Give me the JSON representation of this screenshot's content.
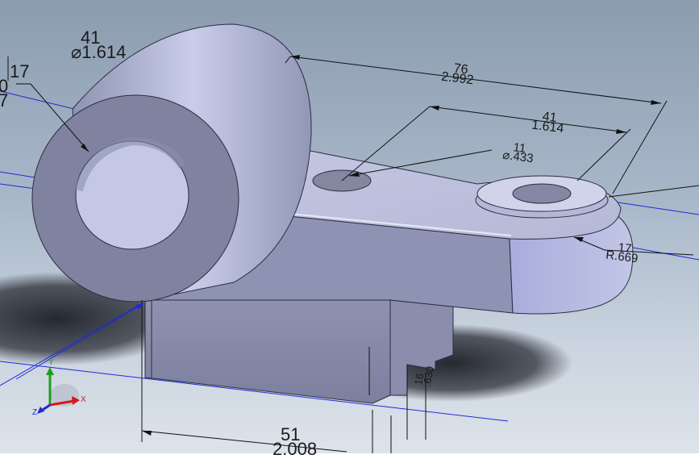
{
  "viewport": {
    "background_top": "#8c9cb0",
    "background_bottom": "#dde3ea",
    "part_color": "#9ea3c4"
  },
  "dimensions": {
    "left_bore_upper": "17",
    "left_bore_lower": "0",
    "left_bore_third": "7",
    "boss_diameter_mm": "41",
    "boss_diameter_in": "⌀1.614",
    "overall_length_mm": "76",
    "overall_length_in": "2.992",
    "hole_spacing_mm": "41",
    "hole_spacing_in": "1.614",
    "hole_diameter_mm": "11",
    "hole_diameter_in": "⌀.433",
    "fillet_radius_mm": "17",
    "fillet_radius_in": "R.669",
    "slot_mm": "16",
    "slot_in": ".630",
    "base_width_mm": "51",
    "base_width_in": "2.008"
  },
  "triad": {
    "x_label": "X",
    "y_label": "Y",
    "z_label": "Z",
    "x_color": "#d21a1a",
    "y_color": "#1aa01a",
    "z_color": "#1a2bd2"
  }
}
